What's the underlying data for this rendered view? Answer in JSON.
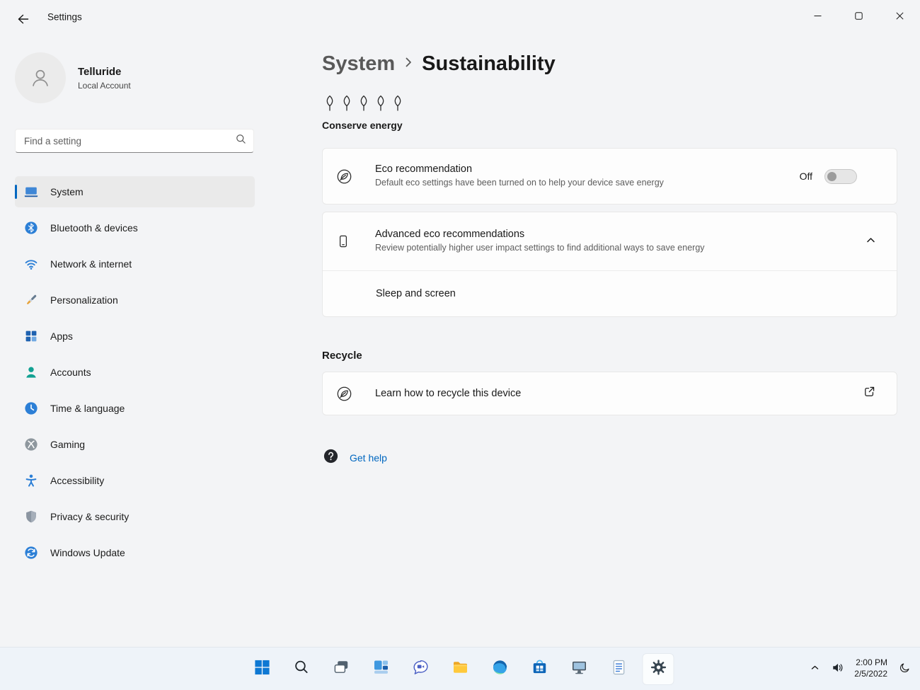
{
  "window": {
    "title": "Settings",
    "controls": [
      "minimize",
      "maximize",
      "close"
    ]
  },
  "sidebar": {
    "user": {
      "name": "Telluride",
      "account_type": "Local Account"
    },
    "search_placeholder": "Find a setting",
    "items": [
      {
        "label": "System",
        "selected": true
      },
      {
        "label": "Bluetooth & devices",
        "selected": false
      },
      {
        "label": "Network & internet",
        "selected": false
      },
      {
        "label": "Personalization",
        "selected": false
      },
      {
        "label": "Apps",
        "selected": false
      },
      {
        "label": "Accounts",
        "selected": false
      },
      {
        "label": "Time & language",
        "selected": false
      },
      {
        "label": "Gaming",
        "selected": false
      },
      {
        "label": "Accessibility",
        "selected": false
      },
      {
        "label": "Privacy & security",
        "selected": false
      },
      {
        "label": "Windows Update",
        "selected": false
      }
    ]
  },
  "main": {
    "breadcrumb": {
      "parent": "System",
      "current": "Sustainability"
    },
    "conserve_energy": {
      "label": "Conserve energy",
      "leaf_count": 5
    },
    "eco_card": {
      "title": "Eco recommendation",
      "description": "Default eco settings have been turned on to help your device save energy",
      "toggle_label": "Off",
      "toggle_on": false
    },
    "advanced_card": {
      "title": "Advanced eco recommendations",
      "description": "Review potentially higher user impact settings to find additional ways to save energy",
      "expanded": true,
      "sub_item": "Sleep and screen"
    },
    "recycle": {
      "heading": "Recycle",
      "link_label": "Learn how to recycle this device"
    },
    "get_help_label": "Get help"
  },
  "taskbar": {
    "buttons": [
      {
        "name": "start"
      },
      {
        "name": "search"
      },
      {
        "name": "task-view"
      },
      {
        "name": "widgets"
      },
      {
        "name": "chat"
      },
      {
        "name": "file-explorer"
      },
      {
        "name": "edge"
      },
      {
        "name": "store"
      },
      {
        "name": "monitor-app"
      },
      {
        "name": "notepad"
      },
      {
        "name": "settings",
        "active": true
      }
    ],
    "tray": {
      "icons": [
        "chevron-up",
        "volume",
        "moon"
      ],
      "time": "2:00 PM",
      "date": "2/5/2022"
    }
  },
  "colors": {
    "accent": "#0067c0",
    "link": "#0067c0",
    "background": "#f3f4f6",
    "card": "#fdfdfd",
    "taskbar": "#eef3f9",
    "selected_nav": "#eaeaea"
  }
}
